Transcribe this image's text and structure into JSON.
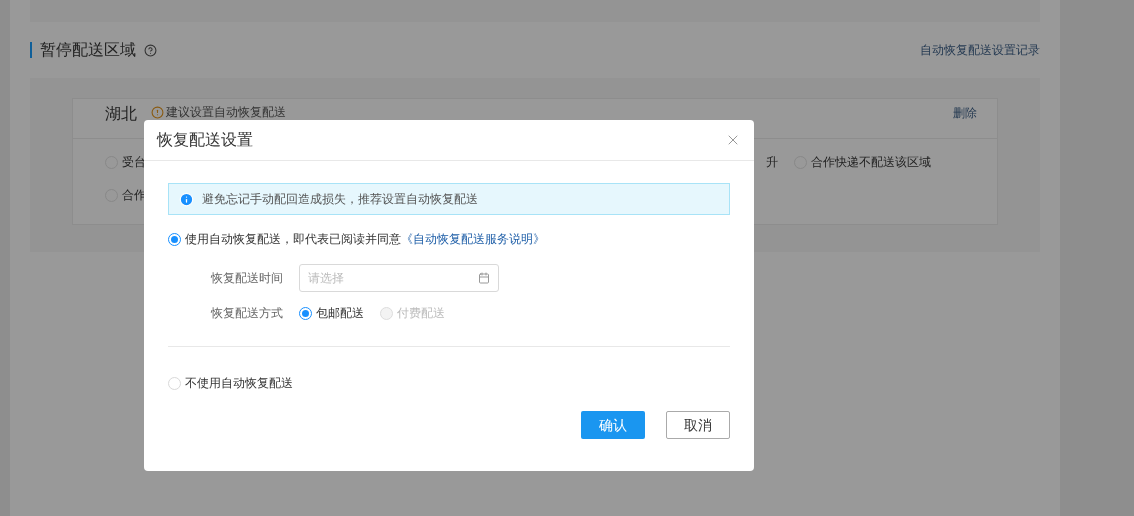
{
  "page": {
    "section_title": "暂停配送区域",
    "record_link": "自动恢复配送设置记录",
    "region": {
      "name": "湖北",
      "warning": "建议设置自动恢复配送",
      "delete": "删除",
      "fragment": "升",
      "rows": [
        [
          {
            "label": "受台",
            "selected": false
          },
          {
            "label": "合作快递不配送该区域",
            "selected": false
          }
        ],
        [
          {
            "label": "合作",
            "selected": false
          }
        ]
      ]
    }
  },
  "dialog": {
    "title": "恢复配送设置",
    "alert": "避免忘记手动配回造成损失，推荐设置自动恢复配送",
    "choices": [
      {
        "text": "使用自动恢复配送，即代表已阅读并同意",
        "link": "《自动恢复配送服务说明》",
        "selected": true
      },
      {
        "text": "不使用自动恢复配送",
        "selected": false
      }
    ],
    "time_field": {
      "label": "恢复配送时间",
      "placeholder": "请选择"
    },
    "method": {
      "label": "恢复配送方式",
      "options": [
        {
          "label": "包邮配送",
          "selected": true,
          "disabled": false
        },
        {
          "label": "付费配送",
          "selected": false,
          "disabled": true
        }
      ]
    },
    "buttons": [
      {
        "label": "确认",
        "kind": "primary"
      },
      {
        "label": "取消",
        "kind": "default"
      }
    ]
  }
}
